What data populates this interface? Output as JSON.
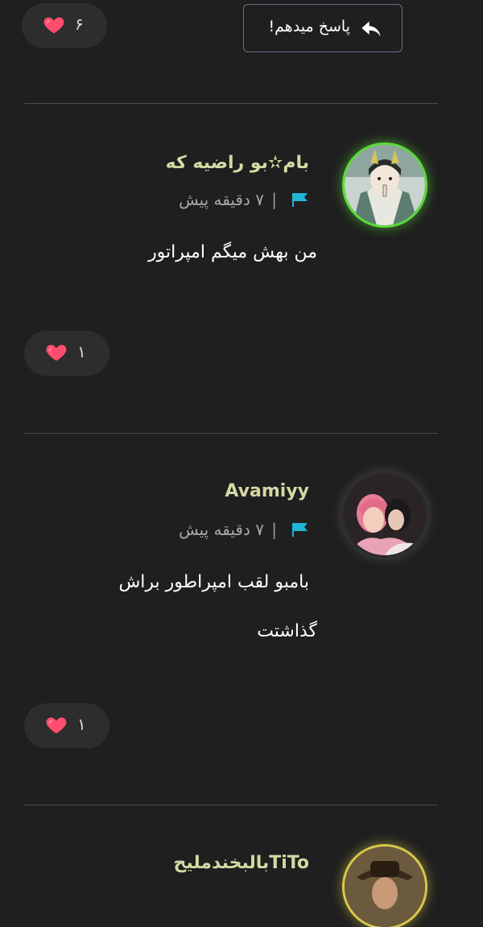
{
  "top": {
    "likes": "۶",
    "reply_label": "پاسخ میدهم!"
  },
  "comments": [
    {
      "username": "بام✫بو راضیه که",
      "time": "۷ دقیقه پیش",
      "separator": "|",
      "text": "من بهش میگم امپراتور",
      "likes": "۱",
      "avatar_ring": "green"
    },
    {
      "username": "Avamiyy",
      "time": "۷ دقیقه پیش",
      "separator": "|",
      "text_line1": "بامبو لقب امپراطور براش",
      "text_line2": "گذاشتت",
      "likes": "۱",
      "avatar_ring": "gray"
    },
    {
      "username": "TiToبالبخندملیح",
      "avatar_ring": "yellow"
    }
  ],
  "colors": {
    "background": "#1f1f1f",
    "username": "#d5d9a3",
    "flag": "#1fb5d6",
    "heart": "#ff4d6d"
  }
}
